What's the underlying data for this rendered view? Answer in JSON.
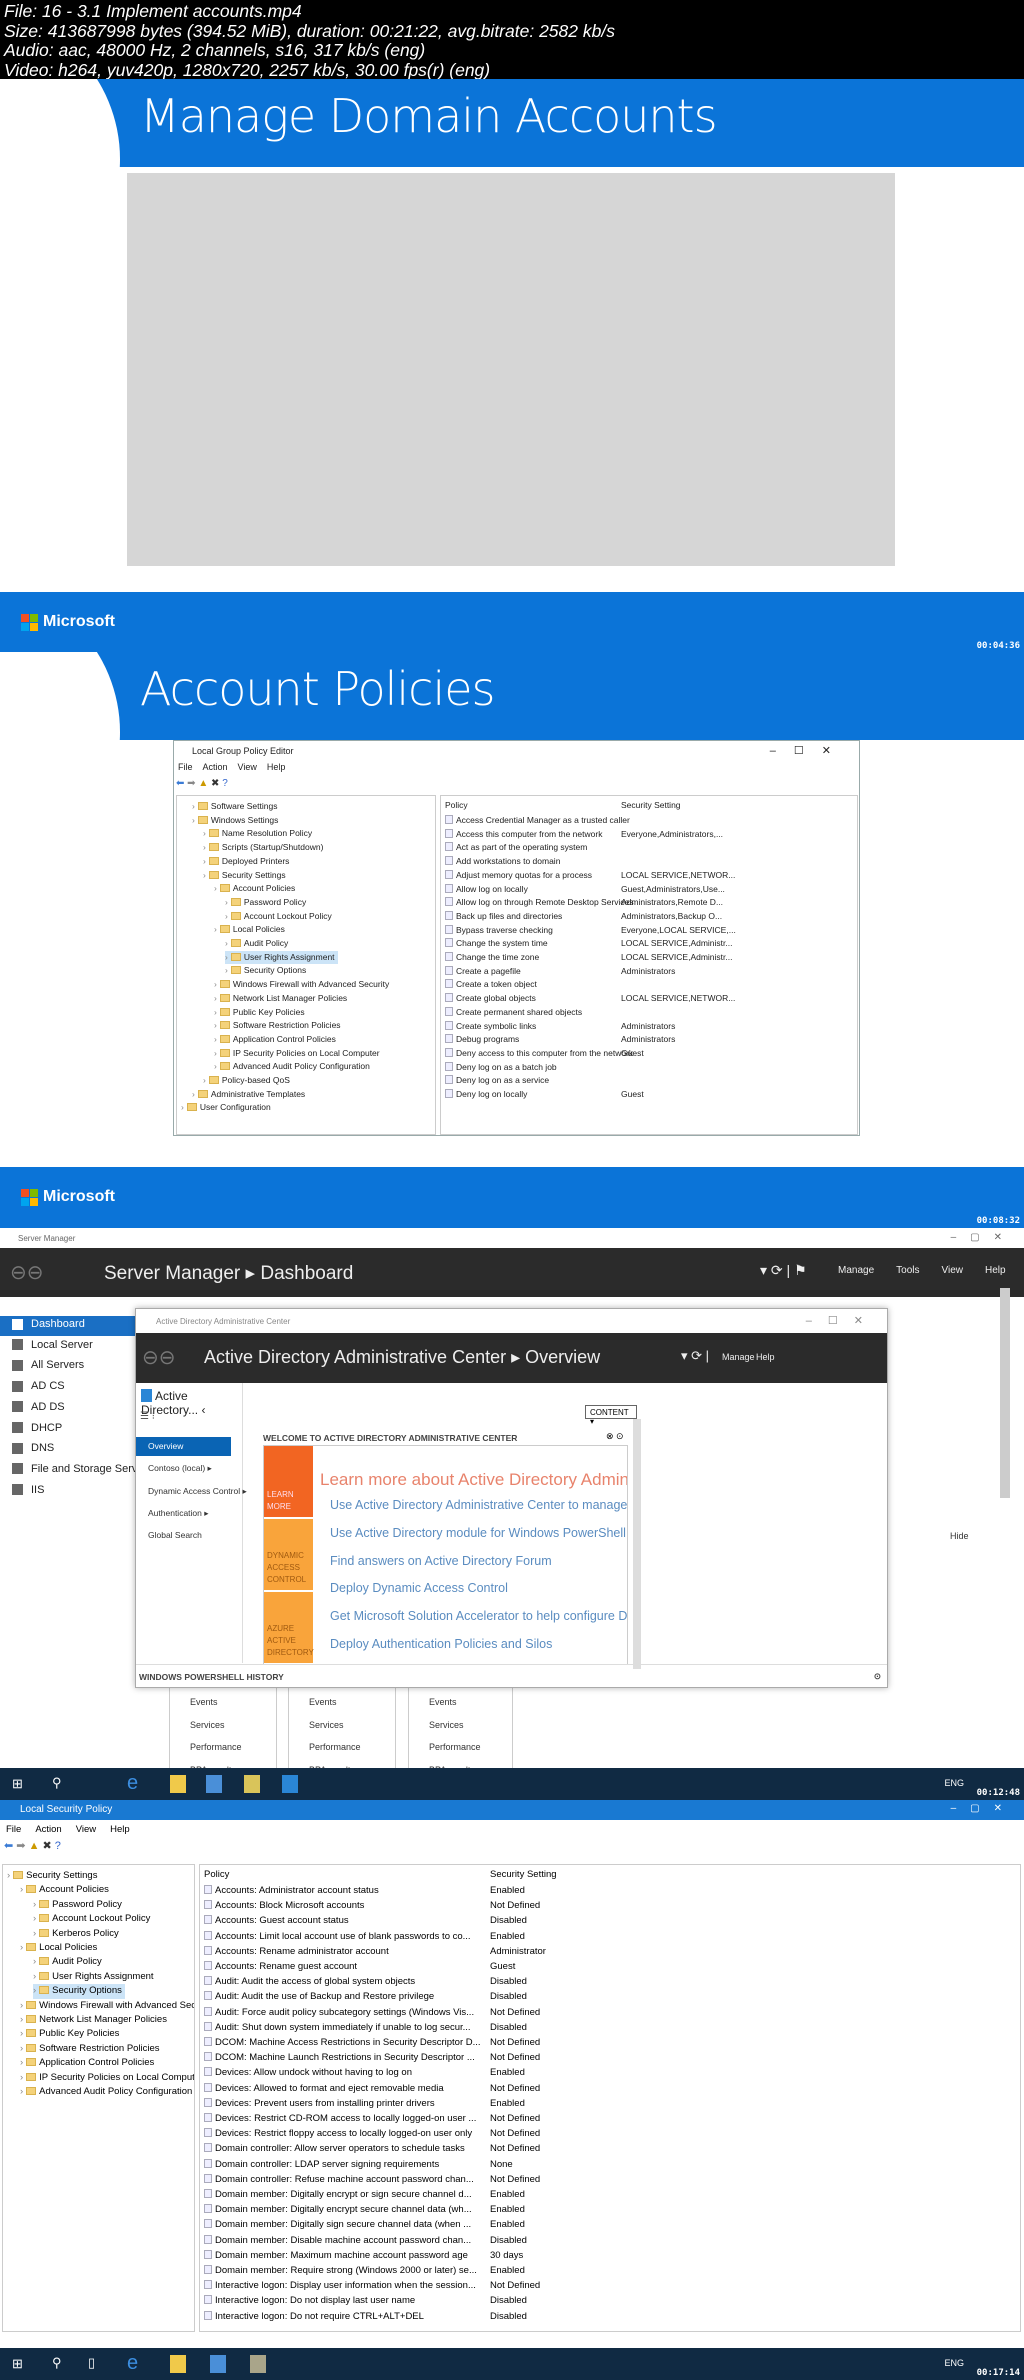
{
  "file_info": {
    "line1": "File: 16 - 3.1 Implement accounts.mp4",
    "line2": "Size: 413687998 bytes (394.52 MiB), duration: 00:21:22, avg.bitrate: 2582 kb/s",
    "line3": "Audio: aac, 48000 Hz, 2 channels, s16, 317 kb/s (eng)",
    "line4": "Video: h264, yuv420p, 1280x720, 2257 kb/s, 30.00 fps(r) (eng)"
  },
  "colors": {
    "slide_blue": "#0b74d8",
    "orange": "#f26522",
    "amber": "#f9a43b",
    "link": "#5a8cc0",
    "selected": "#0a64b4"
  },
  "frame1": {
    "title": "Manage Domain Accounts",
    "logo": "Microsoft",
    "timestamp": "00:04:36"
  },
  "frame2": {
    "title": "Account Policies",
    "logo": "Microsoft",
    "timestamp": "00:08:32",
    "window": {
      "title": "Local Group Policy Editor",
      "menu": [
        "File",
        "Action",
        "View",
        "Help"
      ],
      "tree": [
        [
          "Software Settings",
          1
        ],
        [
          "Windows Settings",
          1
        ],
        [
          "Name Resolution Policy",
          2
        ],
        [
          "Scripts (Startup/Shutdown)",
          2
        ],
        [
          "Deployed Printers",
          2
        ],
        [
          "Security Settings",
          2
        ],
        [
          "Account Policies",
          3
        ],
        [
          "Password Policy",
          4
        ],
        [
          "Account Lockout Policy",
          4
        ],
        [
          "Local Policies",
          3
        ],
        [
          "Audit Policy",
          4
        ],
        [
          "User Rights Assignment",
          4
        ],
        [
          "Security Options",
          4
        ],
        [
          "Windows Firewall with Advanced Security",
          3
        ],
        [
          "Network List Manager Policies",
          3
        ],
        [
          "Public Key Policies",
          3
        ],
        [
          "Software Restriction Policies",
          3
        ],
        [
          "Application Control Policies",
          3
        ],
        [
          "IP Security Policies on Local Computer",
          3
        ],
        [
          "Advanced Audit Policy Configuration",
          3
        ],
        [
          "Policy-based QoS",
          2
        ],
        [
          "Administrative Templates",
          1
        ],
        [
          "User Configuration",
          0
        ]
      ],
      "selected": "User Rights Assignment",
      "columns": [
        "Policy",
        "Security Setting"
      ],
      "rows": [
        [
          "Access Credential Manager as a trusted caller",
          ""
        ],
        [
          "Access this computer from the network",
          "Everyone,Administrators,..."
        ],
        [
          "Act as part of the operating system",
          ""
        ],
        [
          "Add workstations to domain",
          ""
        ],
        [
          "Adjust memory quotas for a process",
          "LOCAL SERVICE,NETWOR..."
        ],
        [
          "Allow log on locally",
          "Guest,Administrators,Use..."
        ],
        [
          "Allow log on through Remote Desktop Services",
          "Administrators,Remote D..."
        ],
        [
          "Back up files and directories",
          "Administrators,Backup O..."
        ],
        [
          "Bypass traverse checking",
          "Everyone,LOCAL SERVICE,..."
        ],
        [
          "Change the system time",
          "LOCAL SERVICE,Administr..."
        ],
        [
          "Change the time zone",
          "LOCAL SERVICE,Administr..."
        ],
        [
          "Create a pagefile",
          "Administrators"
        ],
        [
          "Create a token object",
          ""
        ],
        [
          "Create global objects",
          "LOCAL SERVICE,NETWOR..."
        ],
        [
          "Create permanent shared objects",
          ""
        ],
        [
          "Create symbolic links",
          "Administrators"
        ],
        [
          "Debug programs",
          "Administrators"
        ],
        [
          "Deny access to this computer from the network",
          "Guest"
        ],
        [
          "Deny log on as a batch job",
          ""
        ],
        [
          "Deny log on as a service",
          ""
        ],
        [
          "Deny log on locally",
          "Guest"
        ]
      ]
    }
  },
  "frame3": {
    "timestamp": "00:12:48",
    "server_manager": {
      "title": "Server Manager",
      "breadcrumb": "Server Manager",
      "page": "Dashboard",
      "menu": [
        "Manage",
        "Tools",
        "View",
        "Help"
      ],
      "sidebar": [
        "Dashboard",
        "Local Server",
        "All Servers",
        "AD CS",
        "AD DS",
        "DHCP",
        "DNS",
        "File and Storage Services",
        "IIS"
      ],
      "hide": "Hide",
      "tiles": [
        "Events",
        "Services",
        "Performance",
        "BPA results"
      ]
    },
    "adac": {
      "title": "Active Directory Administrative Center",
      "breadcrumb": "Active Directory Administrative Center",
      "page": "Overview",
      "menu": [
        "Manage",
        "Help"
      ],
      "nav_header": "Active Directory...",
      "nav": [
        "Overview",
        "Contoso (local)",
        "Dynamic Access Control",
        "Authentication",
        "Global Search"
      ],
      "content_dropdown": "CONTENT",
      "welcome": "WELCOME TO ACTIVE DIRECTORY ADMINISTRATIVE CENTER",
      "tiles": [
        "LEARN MORE",
        "DYNAMIC ACCESS CONTROL",
        "AZURE ACTIVE DIRECTORY"
      ],
      "learn_title": "Learn more about Active Directory Administrative Cente",
      "links": [
        "Use Active Directory Administrative Center to manage IT tasks",
        "Use Active Directory module for Windows PowerShell",
        "Find answers on Active Directory Forum",
        "Deploy Dynamic Access Control",
        "Get Microsoft Solution Accelerator to help configure Dynamic Access C",
        "Deploy Authentication Policies and Silos"
      ],
      "powershell": "WINDOWS POWERSHELL HISTORY"
    },
    "tray_lang": "ENG"
  },
  "frame4": {
    "timestamp": "00:17:14",
    "tray_lang": "ENG",
    "window": {
      "title": "Local Security Policy",
      "menu": [
        "File",
        "Action",
        "View",
        "Help"
      ],
      "tree": [
        [
          "Security Settings",
          0
        ],
        [
          "Account Policies",
          1
        ],
        [
          "Password Policy",
          2
        ],
        [
          "Account Lockout Policy",
          2
        ],
        [
          "Kerberos Policy",
          2
        ],
        [
          "Local Policies",
          1
        ],
        [
          "Audit Policy",
          2
        ],
        [
          "User Rights Assignment",
          2
        ],
        [
          "Security Options",
          2
        ],
        [
          "Windows Firewall with Advanced Security",
          1
        ],
        [
          "Network List Manager Policies",
          1
        ],
        [
          "Public Key Policies",
          1
        ],
        [
          "Software Restriction Policies",
          1
        ],
        [
          "Application Control Policies",
          1
        ],
        [
          "IP Security Policies on Local Computer",
          1
        ],
        [
          "Advanced Audit Policy Configuration",
          1
        ]
      ],
      "selected": "Security Options",
      "columns": [
        "Policy",
        "Security Setting"
      ],
      "rows": [
        [
          "Accounts: Administrator account status",
          "Enabled"
        ],
        [
          "Accounts: Block Microsoft accounts",
          "Not Defined"
        ],
        [
          "Accounts: Guest account status",
          "Disabled"
        ],
        [
          "Accounts: Limit local account use of blank passwords to co...",
          "Enabled"
        ],
        [
          "Accounts: Rename administrator account",
          "Administrator"
        ],
        [
          "Accounts: Rename guest account",
          "Guest"
        ],
        [
          "Audit: Audit the access of global system objects",
          "Disabled"
        ],
        [
          "Audit: Audit the use of Backup and Restore privilege",
          "Disabled"
        ],
        [
          "Audit: Force audit policy subcategory settings (Windows Vis...",
          "Not Defined"
        ],
        [
          "Audit: Shut down system immediately if unable to log secur...",
          "Disabled"
        ],
        [
          "DCOM: Machine Access Restrictions in Security Descriptor D...",
          "Not Defined"
        ],
        [
          "DCOM: Machine Launch Restrictions in Security Descriptor ...",
          "Not Defined"
        ],
        [
          "Devices: Allow undock without having to log on",
          "Enabled"
        ],
        [
          "Devices: Allowed to format and eject removable media",
          "Not Defined"
        ],
        [
          "Devices: Prevent users from installing printer drivers",
          "Enabled"
        ],
        [
          "Devices: Restrict CD-ROM access to locally logged-on user ...",
          "Not Defined"
        ],
        [
          "Devices: Restrict floppy access to locally logged-on user only",
          "Not Defined"
        ],
        [
          "Domain controller: Allow server operators to schedule tasks",
          "Not Defined"
        ],
        [
          "Domain controller: LDAP server signing requirements",
          "None"
        ],
        [
          "Domain controller: Refuse machine account password chan...",
          "Not Defined"
        ],
        [
          "Domain member: Digitally encrypt or sign secure channel d...",
          "Enabled"
        ],
        [
          "Domain member: Digitally encrypt secure channel data (wh...",
          "Enabled"
        ],
        [
          "Domain member: Digitally sign secure channel data (when ...",
          "Enabled"
        ],
        [
          "Domain member: Disable machine account password chan...",
          "Disabled"
        ],
        [
          "Domain member: Maximum machine account password age",
          "30 days"
        ],
        [
          "Domain member: Require strong (Windows 2000 or later) se...",
          "Enabled"
        ],
        [
          "Interactive logon: Display user information when the session...",
          "Not Defined"
        ],
        [
          "Interactive logon: Do not display last user name",
          "Disabled"
        ],
        [
          "Interactive logon: Do not require CTRL+ALT+DEL",
          "Disabled"
        ]
      ]
    }
  }
}
